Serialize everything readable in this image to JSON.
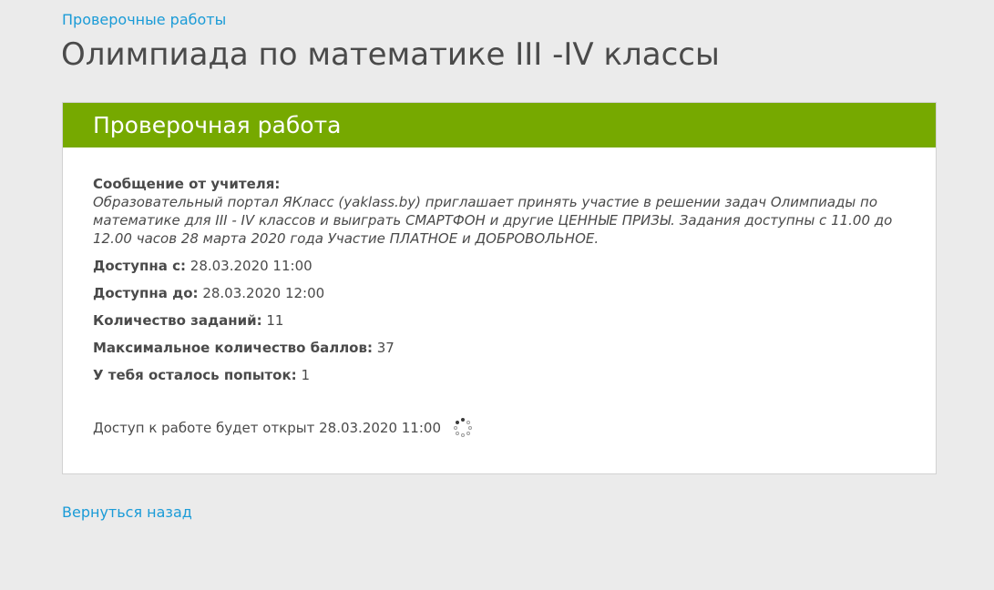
{
  "breadcrumb": {
    "label": "Проверочные работы"
  },
  "page": {
    "title": "Олимпиада по математике III -IV классы"
  },
  "card": {
    "header_title": "Проверочная работа",
    "header_color": "#76a900",
    "message_label": "Сообщение от учителя:",
    "message_text": "Образовательный портал ЯКласс (yaklass.by) приглашает принять участие в решении задач Олимпиады по математике для III - IV классов и выиграть СМАРТФОН и другие ЦЕННЫЕ ПРИЗЫ. Задания доступны с 11.00 до 12.00 часов 28 марта 2020 года Участие ПЛАТНОЕ и ДОБРОВОЛЬНОЕ.",
    "info": [
      {
        "label": "Доступна с:",
        "value": "28.03.2020 11:00"
      },
      {
        "label": "Доступна до:",
        "value": "28.03.2020 12:00"
      },
      {
        "label": "Количество заданий:",
        "value": "11"
      },
      {
        "label": "Максимальное количество баллов:",
        "value": "37"
      },
      {
        "label": "У тебя осталось попыток:",
        "value": "1"
      }
    ],
    "access_text": "Доступ к работе будет открыт 28.03.2020 11:00",
    "spinner_icon": "loading-spinner-icon"
  },
  "footer": {
    "back_label": "Вернуться назад"
  },
  "colors": {
    "link": "#1a9bd7",
    "background": "#ebebeb",
    "text": "#4a4a4a"
  }
}
